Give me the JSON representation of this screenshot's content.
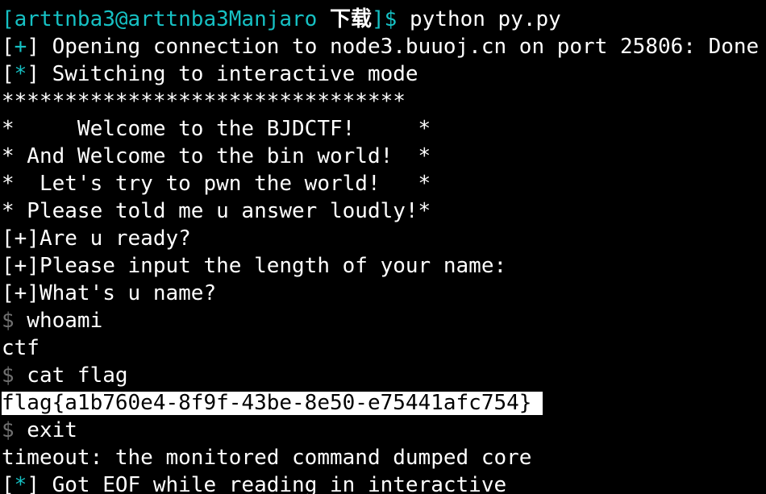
{
  "terminal": {
    "prompt": {
      "open_bracket": "[",
      "user_host": "arttnba3@arttnba3Manjaro",
      "directory": "下载",
      "close_bracket_dollar": "]$",
      "command": "python py.py"
    },
    "line_opening": {
      "open": "[",
      "mark": "+",
      "close": "]",
      "text": " Opening connection to node3.buuoj.cn on port 25806: Done"
    },
    "line_switching": {
      "open": "[",
      "mark": "*",
      "close": "]",
      "text": " Switching to interactive mode"
    },
    "banner": [
      "********************************",
      "*     Welcome to the BJDCTF!     *",
      "* And Welcome to the bin world!  *",
      "*  Let's try to pwn the world!   *",
      "* Please told me u answer loudly!*"
    ],
    "program_lines": [
      "[+]Are u ready?",
      "[+]Please input the length of your name:",
      "[+]What's u name?"
    ],
    "shell1": {
      "dollar": "$",
      "command": " whoami"
    },
    "output1": "ctf",
    "shell2": {
      "dollar": "$",
      "command": " cat flag"
    },
    "flag": "flag{a1b760e4-8f9f-43be-8e50-e75441afc754}",
    "shell3": {
      "dollar": "$",
      "command": " exit"
    },
    "timeout_line": "timeout: the monitored command dumped core",
    "line_eof": {
      "open": "[",
      "mark": "*",
      "close": "]",
      "text": " Got EOF while reading in interactive"
    }
  },
  "colors": {
    "background": "#000000",
    "foreground": "#ffffff",
    "accent_cyan": "#16c1c4",
    "dim_gray": "#6f6f6f",
    "highlight_bg": "#ffffff"
  }
}
